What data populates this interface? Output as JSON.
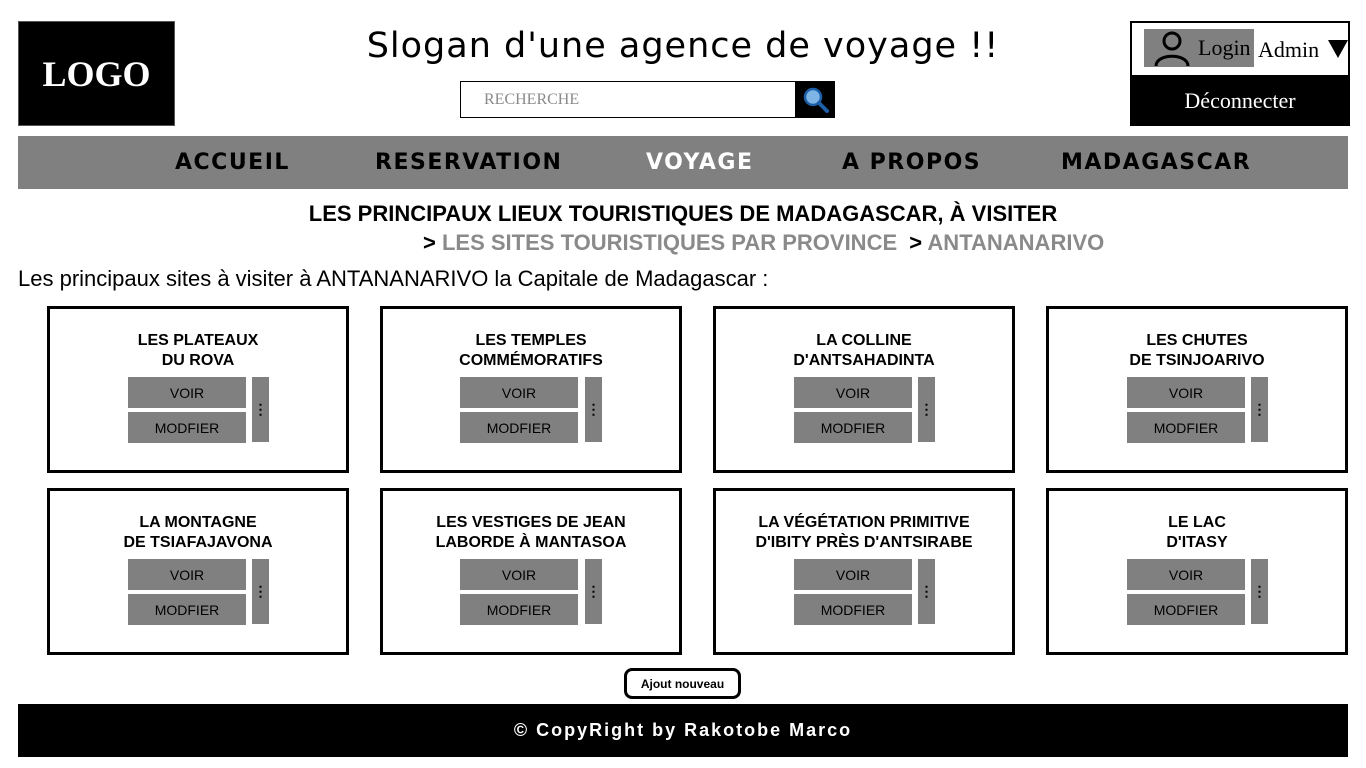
{
  "header": {
    "logo_text": "LOGO",
    "slogan": "Slogan d'une agence de voyage !!",
    "search": {
      "placeholder": "RECHERCHE",
      "value": ""
    },
    "account": {
      "login_label": "Login",
      "user_label": "Admin",
      "logout_label": "Déconnecter"
    }
  },
  "nav": {
    "items": [
      {
        "label": "ACCUEIL"
      },
      {
        "label": "RESERVATION"
      },
      {
        "label": "VOYAGE"
      },
      {
        "label": "A PROPOS"
      },
      {
        "label": "MADAGASCAR"
      }
    ],
    "active": "VOYAGE"
  },
  "main": {
    "title": "LES PRINCIPAUX LIEUX TOURISTIQUES DE MADAGASCAR, À VISITER",
    "breadcrumb": {
      "separator": ">",
      "items": [
        {
          "label": "LES SITES TOURISTIQUES PAR PROVINCE"
        },
        {
          "label": "ANTANANARIVO"
        }
      ]
    },
    "intro": "Les principaux sites à visiter à ANTANANARIVO la Capitale de Madagascar :",
    "cards": [
      {
        "title": "LES PLATEAUX\nDU ROVA",
        "voir": "VOIR",
        "modifier": "MODFIER",
        "more": "⋮"
      },
      {
        "title": "LES TEMPLES\nCOMMÉMORATIFS",
        "voir": "VOIR",
        "modifier": "MODFIER",
        "more": "⋮"
      },
      {
        "title": "LA COLLINE\nD'ANTSAHADINTA",
        "voir": "VOIR",
        "modifier": "MODFIER",
        "more": "⋮"
      },
      {
        "title": "LES CHUTES\nDE TSINJOARIVO",
        "voir": "VOIR",
        "modifier": "MODFIER",
        "more": "⋮"
      },
      {
        "title": "LA MONTAGNE\nDE TSIAFAJAVONA",
        "voir": "VOIR",
        "modifier": "MODFIER",
        "more": "⋮"
      },
      {
        "title": "LES VESTIGES DE JEAN\nLABORDE À MANTASOA",
        "voir": "VOIR",
        "modifier": "MODFIER",
        "more": "⋮"
      },
      {
        "title": "LA VÉGÉTATION PRIMITIVE\nD'IBITY PRÈS D'ANTSIRABE",
        "voir": "VOIR",
        "modifier": "MODFIER",
        "more": "⋮"
      },
      {
        "title": "LE LAC\nD'ITASY",
        "voir": "VOIR",
        "modifier": "MODFIER",
        "more": "⋮"
      }
    ],
    "add_button": "Ajout nouveau"
  },
  "footer": {
    "text": "© CopyRight by Rakotobe Marco"
  },
  "icons": {
    "search": "search-icon",
    "user": "user-icon",
    "dropdown": "caret-down-icon",
    "more": "vertical-dots-icon"
  },
  "colors": {
    "nav_bg": "#808080",
    "button_bg": "#808080",
    "active_nav": "#ffffff",
    "breadcrumb_link": "#8a8a8a"
  }
}
